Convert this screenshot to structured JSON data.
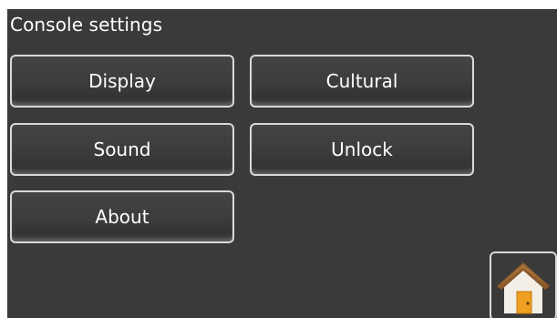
{
  "header": {
    "title": "Console settings"
  },
  "buttons": {
    "display": "Display",
    "cultural": "Cultural",
    "sound": "Sound",
    "unlock": "Unlock",
    "about": "About"
  },
  "icons": {
    "home": "home-icon"
  },
  "colors": {
    "background": "#3a3a3a",
    "border": "#d9d9d9",
    "text": "#ffffff",
    "roof": "#8a5a2b",
    "door": "#f0a020"
  }
}
